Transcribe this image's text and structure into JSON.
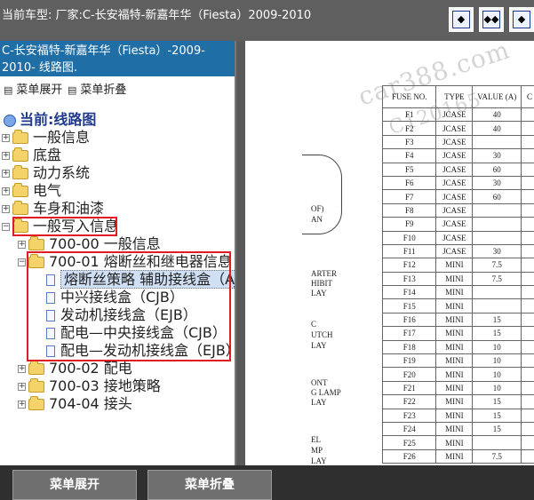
{
  "window": {
    "title": "当前车型:  厂家:C-长安福特-新嘉年华（Fiesta）2009-2010",
    "buttons": [
      "◆",
      "◆◆",
      "◆"
    ]
  },
  "sidebar": {
    "selected_path": "C-长安福特-新嘉年华（Fiesta）-2009-2010- 线路图.",
    "expand_label": "菜单展开",
    "collapse_label": "菜单折叠",
    "root": "当前:线路图",
    "items": [
      {
        "label": "一般信息",
        "toggle": "+"
      },
      {
        "label": "底盘",
        "toggle": "+"
      },
      {
        "label": "动力系统",
        "toggle": "+"
      },
      {
        "label": "电气",
        "toggle": "+"
      },
      {
        "label": "车身和油漆",
        "toggle": "+"
      },
      {
        "label": "一般写入信息",
        "toggle": "−"
      },
      {
        "label": "700-00 一般信息",
        "toggle": "+"
      },
      {
        "label": "700-01 熔断丝和继电器信息",
        "toggle": "−"
      },
      {
        "label": "熔断丝策略 辅助接线盒（AJB）",
        "toggle": ""
      },
      {
        "label": "中兴接线盒（CJB）",
        "toggle": ""
      },
      {
        "label": "发动机接线盒（EJB）",
        "toggle": ""
      },
      {
        "label": "配电—中央接线盒（CJB）",
        "toggle": ""
      },
      {
        "label": "配电—发动机接线盒（EJB）",
        "toggle": ""
      },
      {
        "label": "700-02 配电",
        "toggle": "+"
      },
      {
        "label": "700-03 接地策略",
        "toggle": "+"
      },
      {
        "label": "704-04 接头",
        "toggle": "+"
      }
    ],
    "highlight_color": "#e01b24"
  },
  "document": {
    "watermark": "car388.com",
    "watermark2": "C120165",
    "headers": [
      "FUSE NO.",
      "TYPE",
      "VALUE (A)",
      "C"
    ],
    "rows": [
      [
        "F1",
        "JCASE",
        "40"
      ],
      [
        "F2",
        "JCASE",
        "40"
      ],
      [
        "F3",
        "JCASE",
        ""
      ],
      [
        "F4",
        "JCASE",
        "30"
      ],
      [
        "F5",
        "JCASE",
        "60"
      ],
      [
        "F6",
        "JCASE",
        "30"
      ],
      [
        "F7",
        "JCASE",
        "60"
      ],
      [
        "F8",
        "JCASE",
        ""
      ],
      [
        "F9",
        "JCASE",
        ""
      ],
      [
        "F10",
        "JCASE",
        ""
      ],
      [
        "F11",
        "JCASE",
        "30"
      ],
      [
        "F12",
        "MINI",
        "7.5"
      ],
      [
        "F13",
        "MINI",
        "7.5"
      ],
      [
        "F14",
        "MINI",
        ""
      ],
      [
        "F15",
        "MINI",
        ""
      ],
      [
        "F16",
        "MINI",
        "15"
      ],
      [
        "F17",
        "MINI",
        "15"
      ],
      [
        "F18",
        "MINI",
        "10"
      ],
      [
        "F19",
        "MINI",
        "10"
      ],
      [
        "F20",
        "MINI",
        "10"
      ],
      [
        "F21",
        "MINI",
        "10"
      ],
      [
        "F22",
        "MINI",
        "15"
      ],
      [
        "F23",
        "MINI",
        "15"
      ],
      [
        "F24",
        "MINI",
        "15"
      ],
      [
        "F25",
        "MINI",
        ""
      ],
      [
        "F26",
        "MINI",
        "7.5"
      ]
    ],
    "side_labels": [
      "OF)",
      "AN",
      "ARTER",
      "HIBIT",
      "LAY",
      "C",
      "UTCH",
      "LAY",
      "ONT",
      "G LAMP",
      "LAY",
      "EL",
      "MP",
      "LAY"
    ]
  },
  "footer": {
    "expand_button": "菜单展开",
    "collapse_button": "菜单折叠"
  }
}
